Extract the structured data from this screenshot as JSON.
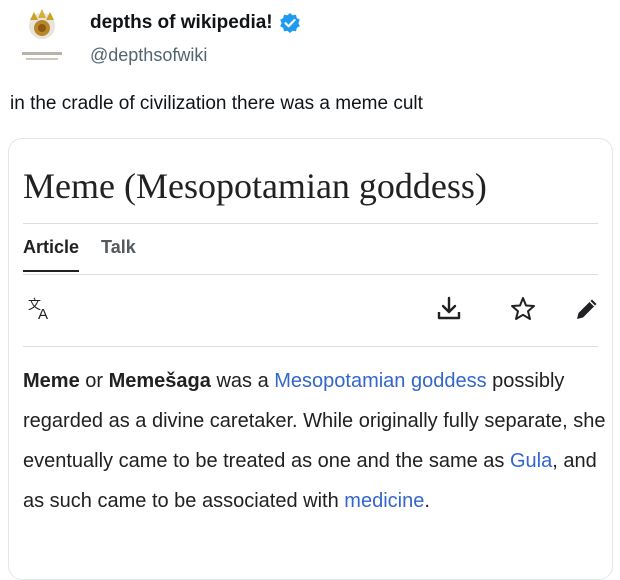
{
  "tweet": {
    "display_name": "depths of wikipedia!",
    "handle": "@depthsofwiki",
    "text": "in the cradle of civilization there was a meme cult",
    "verified_color": "#1d9bf0"
  },
  "article": {
    "title": "Meme (Mesopotamian goddess)",
    "tabs": [
      {
        "label": "Article",
        "active": true
      },
      {
        "label": "Talk",
        "active": false
      }
    ],
    "toolbar_icons": [
      "translate-icon",
      "download-icon",
      "star-icon",
      "pencil-icon"
    ],
    "body": {
      "bold_1": "Meme",
      "t1": " or ",
      "bold_2": "Memešaga",
      "t2": " was a ",
      "link_1": "Mesopotamian goddess",
      "t3": " possibly regarded as a divine caretaker. While originally fully separate, she eventually came to be treated as one and the same as ",
      "link_2": "Gula",
      "t4": ", and as such came to be associated with ",
      "link_3": "medicine",
      "t5": "."
    },
    "link_color": "#3366cc"
  }
}
